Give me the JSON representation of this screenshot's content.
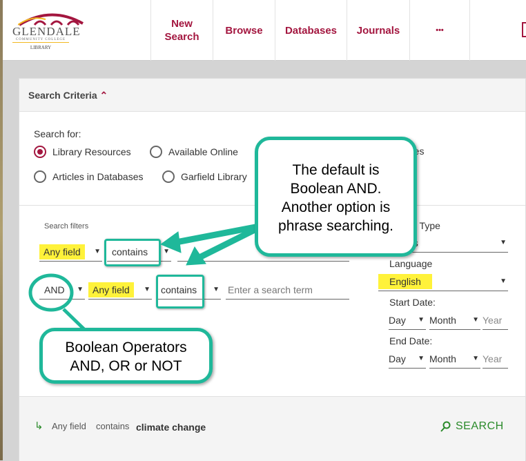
{
  "logo": {
    "name": "GLENDALE",
    "sub": "COMMUNITY COLLEGE",
    "library": "LIBRARY"
  },
  "nav": [
    "New Search",
    "Browse",
    "Databases",
    "Journals",
    "•••"
  ],
  "panel": {
    "title": "Search Criteria",
    "search_for_label": "Search for:",
    "radios": [
      {
        "label": "Library Resources",
        "selected": true
      },
      {
        "label": "Available Online",
        "selected": false
      },
      {
        "label": "rves",
        "selected": false
      },
      {
        "label": "Articles in Databases",
        "selected": false
      },
      {
        "label": "Garfield Library",
        "selected": false
      }
    ],
    "filters_label": "Search filters",
    "row1": {
      "field": "Any field",
      "op": "contains",
      "term": ""
    },
    "row2": {
      "bool": "AND",
      "field": "Any field",
      "op": "contains",
      "placeholder": "Enter a search term"
    },
    "material_type_label": "al Type",
    "material_type_value": "ns",
    "language_label": "Language",
    "language_value": "English",
    "start_date_label": "Start Date:",
    "end_date_label": "End Date:",
    "day": "Day",
    "month": "Month",
    "year": "Year",
    "query": {
      "field": "Any field",
      "op": "contains",
      "term": "climate change"
    },
    "search_button": "SEARCH"
  },
  "callouts": {
    "top": "The default is Boolean AND. Another option is phrase searching.",
    "bottom_line1": "Boolean Operators",
    "bottom_line2": "AND, OR or NOT"
  },
  "colors": {
    "brand": "#a3163f",
    "callout": "#1fb89a",
    "highlight": "#fff23a",
    "search": "#2a8a2a"
  }
}
